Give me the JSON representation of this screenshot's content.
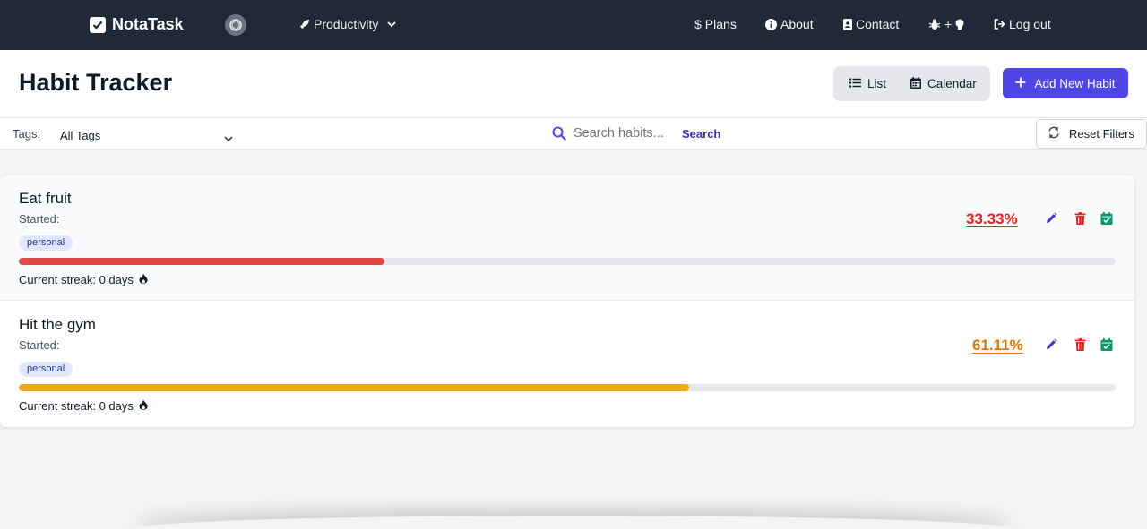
{
  "navbar": {
    "brand": "NotaTask",
    "productivity_label": "Productivity",
    "plans_label": "Plans",
    "about_label": "About",
    "contact_label": "Contact",
    "feedback_label": "+",
    "logout_label": "Log out",
    "icons": [
      "check-square-icon",
      "openai-icon",
      "rocket-icon",
      "chevron-down-icon",
      "dollar-icon",
      "info-icon",
      "contact-book-icon",
      "bug-icon",
      "lightbulb-icon",
      "logout-icon"
    ]
  },
  "header": {
    "title": "Habit Tracker",
    "list_label": "List",
    "calendar_label": "Calendar",
    "add_label": "Add New Habit"
  },
  "filters": {
    "tags_label": "Tags:",
    "tags_value": "All Tags",
    "search_placeholder": "Search habits...",
    "search_button": "Search",
    "reset_label": "Reset Filters"
  },
  "habits": [
    {
      "name": "Eat fruit",
      "started_label": "Started:",
      "tag": "personal",
      "progress_percent": 33.33,
      "percent_text": "33.33%",
      "color": "#dc2626",
      "bar_color": "#e04848",
      "streak_text": "Current streak: 0 days"
    },
    {
      "name": "Hit the gym",
      "started_label": "Started:",
      "tag": "personal",
      "progress_percent": 61.11,
      "percent_text": "61.11%",
      "color": "#d97706",
      "bar_color": "#f0a81a",
      "streak_text": "Current streak: 0 days"
    }
  ],
  "colors": {
    "navbar_bg": "#1f2937",
    "accent": "#4f46e5",
    "edit": "#4338ca",
    "delete": "#dc2626",
    "complete": "#059669"
  }
}
